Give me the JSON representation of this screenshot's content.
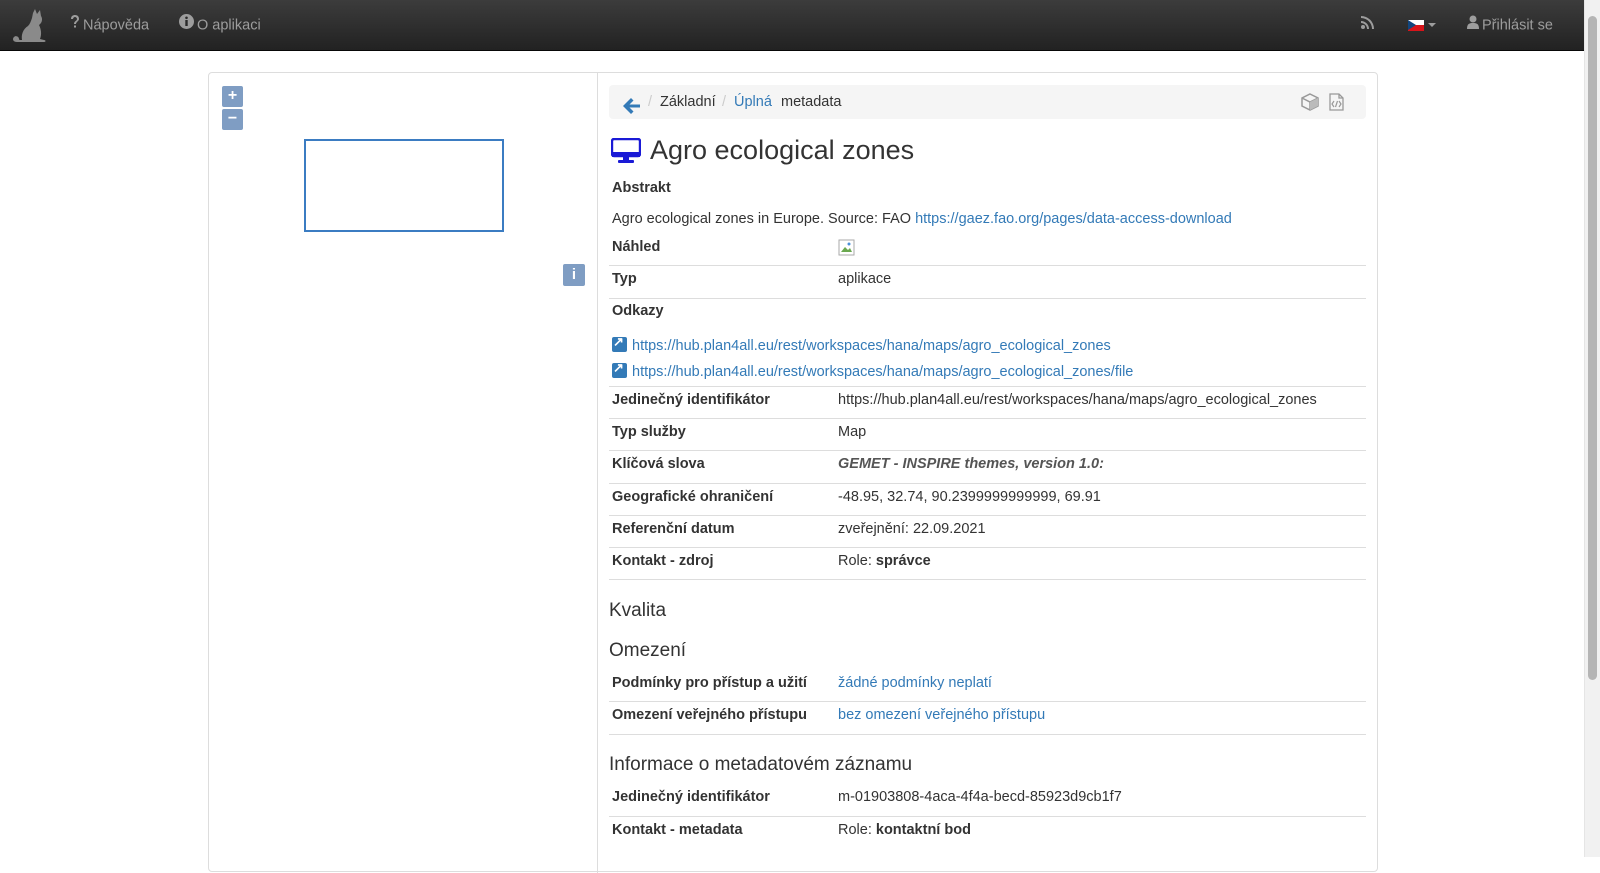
{
  "nav": {
    "help_label": "Nápověda",
    "about_label": "O aplikaci",
    "login_label": "Přihlásit se",
    "language": "cs"
  },
  "map": {
    "zoom_in": "+",
    "zoom_out": "−",
    "info": "i"
  },
  "breadcrumb": {
    "basic": "Základní",
    "full": "Úplná",
    "metadata": "metadata",
    "separator": "/"
  },
  "record": {
    "title": "Agro ecological zones",
    "abstract_label": "Abstrakt",
    "abstract_text": "Agro ecological zones in Europe. Source: FAO",
    "abstract_link": "https://gaez.fao.org/pages/data-access-download",
    "preview_label": "Náhled",
    "type_label": "Typ",
    "type_value": "aplikace",
    "links_label": "Odkazy",
    "links": [
      "https://hub.plan4all.eu/rest/workspaces/hana/maps/agro_ecological_zones",
      "https://hub.plan4all.eu/rest/workspaces/hana/maps/agro_ecological_zones/file"
    ],
    "identifier_label": "Jedinečný identifikátor",
    "identifier_value": "https://hub.plan4all.eu/rest/workspaces/hana/maps/agro_ecological_zones",
    "service_type_label": "Typ služby",
    "service_type_value": "Map",
    "keywords_label": "Klíčová slova",
    "keywords_value": "GEMET - INSPIRE themes, version 1.0:",
    "bbox_label": "Geografické ohraničení",
    "bbox_value": "-48.95, 32.74, 90.2399999999999, 69.91",
    "refdate_label": "Referenční datum",
    "refdate_value": "zveřejnění: 22.09.2021",
    "contact_label": "Kontakt - zdroj",
    "contact_role_prefix": "Role:",
    "contact_role": "správce"
  },
  "quality": {
    "heading": "Kvalita"
  },
  "constraints": {
    "heading": "Omezení",
    "access_label": "Podmínky pro přístup a užití",
    "access_value": "žádné podmínky neplatí",
    "public_label": "Omezení veřejného přístupu",
    "public_value": "bez omezení veřejného přístupu"
  },
  "metarecord": {
    "heading": "Informace o metadatovém záznamu",
    "identifier_label": "Jedinečný identifikátor",
    "identifier_value": "m-01903808-4aca-4f4a-becd-85923d9cb1f7",
    "contact_label": "Kontakt - metadata",
    "contact_role_prefix": "Role:",
    "contact_role": "kontaktní bod"
  },
  "colors": {
    "navbar": "#222222",
    "link": "#337ab7",
    "title_icon": "#1a1ad6"
  }
}
